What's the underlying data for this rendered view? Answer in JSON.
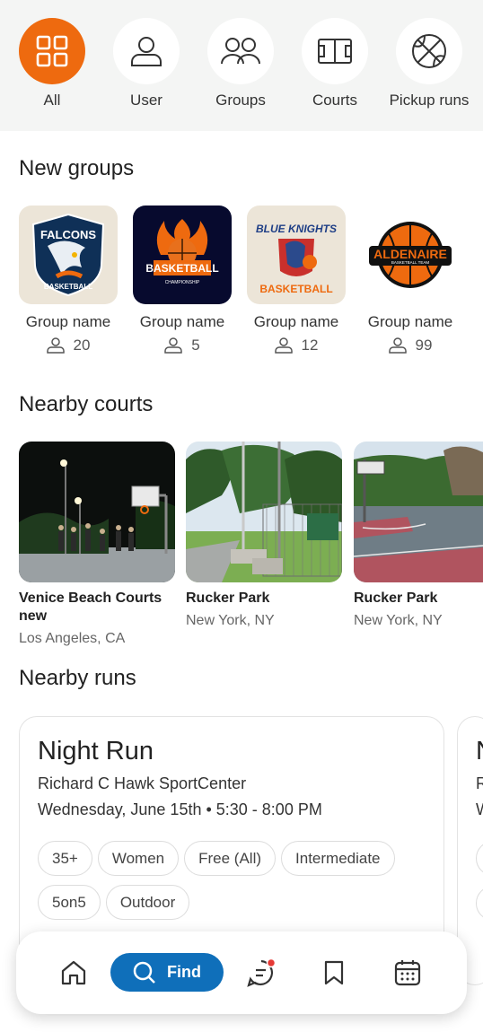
{
  "categories": [
    {
      "label": "All",
      "icon": "grid-icon",
      "active": true
    },
    {
      "label": "User",
      "icon": "user-icon"
    },
    {
      "label": "Groups",
      "icon": "groups-icon"
    },
    {
      "label": "Courts",
      "icon": "court-icon"
    },
    {
      "label": "Pickup runs",
      "icon": "basketball-icon"
    }
  ],
  "sections": {
    "new_groups": "New groups",
    "nearby_courts": "Nearby courts",
    "nearby_runs": "Nearby runs"
  },
  "groups": [
    {
      "name": "Group name",
      "members": "20",
      "logo_text": [
        "FALCONS",
        "BASKETBALL"
      ],
      "logo": "falcons-logo"
    },
    {
      "name": "Group name",
      "members": "5",
      "logo_text": [
        "BASKETBALL",
        "CHAMPIONSHIP"
      ],
      "logo": "basketball-flame-logo"
    },
    {
      "name": "Group name",
      "members": "12",
      "logo_text": [
        "BLUE KNIGHTS",
        "BASKETBALL"
      ],
      "logo": "blue-knights-logo"
    },
    {
      "name": "Group name",
      "members": "99",
      "logo_text": [
        "ALDENAIRE",
        "BASKETBALL TEAM"
      ],
      "logo": "aldenaire-logo"
    }
  ],
  "courts": [
    {
      "name": "Venice Beach Courts new",
      "location": "Los Angeles, CA"
    },
    {
      "name": "Rucker Park",
      "location": "New York, NY"
    },
    {
      "name": "Rucker Park",
      "location": "New York, NY"
    }
  ],
  "runs": [
    {
      "title": "Night Run",
      "venue": "Richard C Hawk SportCenter",
      "time": "Wednesday, June 15th • 5:30 - 8:00 PM",
      "tags": [
        "35+",
        "Women",
        "Free (All)",
        "Intermediate",
        "5on5",
        "Outdoor"
      ]
    },
    {
      "title": "N",
      "venue": "R",
      "time": "W"
    }
  ],
  "nav": {
    "find_label": "Find",
    "items": [
      "home-icon",
      "search-icon",
      "chat-icon",
      "bookmark-icon",
      "calendar-icon"
    ]
  },
  "colors": {
    "accent": "#ee6a0f",
    "primary": "#0f6fba",
    "notification": "#e53935"
  }
}
